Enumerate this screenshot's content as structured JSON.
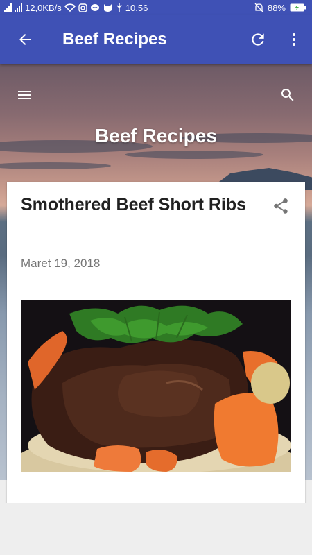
{
  "status_bar": {
    "network_speed": "12,0KB/s",
    "time": "10.56",
    "battery": "88%"
  },
  "app_bar": {
    "title": "Beef Recipes",
    "back_icon": "arrow-back-icon",
    "refresh_icon": "refresh-icon",
    "more_icon": "more-vert-icon"
  },
  "blog": {
    "title": "Beef Recipes",
    "menu_icon": "hamburger-menu-icon",
    "search_icon": "search-icon"
  },
  "post": {
    "title": "Smothered Beef Short Ribs",
    "date": "Maret 19, 2018",
    "share_icon": "share-icon",
    "image_alt": "beef short ribs with carrots and parsley"
  },
  "colors": {
    "primary": "#3f51b5",
    "card_bg": "#ffffff",
    "title_text": "#212121",
    "date_text": "#757575"
  }
}
